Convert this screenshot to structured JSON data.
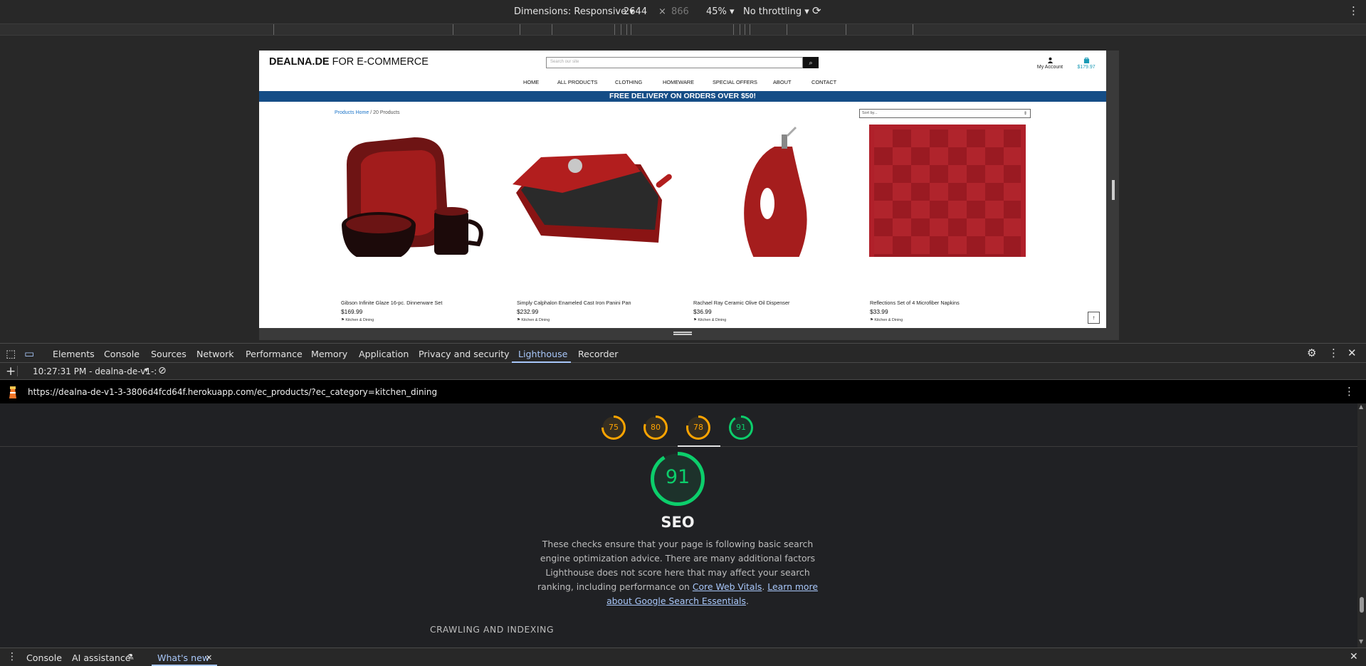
{
  "device_toolbar": {
    "dimensions_label": "Dimensions: Responsive",
    "width": "2644",
    "times": "×",
    "height": "866",
    "zoom": "45%",
    "throttling": "No throttling"
  },
  "site": {
    "logo_bold": "DEALNA.DE",
    "logo_rest": " FOR E-COMMERCE",
    "search_placeholder": "Search our site",
    "account_label": "My Account",
    "cart_total": "$179.97",
    "nav": [
      "HOME",
      "ALL PRODUCTS",
      "CLOTHING",
      "HOMEWARE",
      "SPECIAL OFFERS",
      "ABOUT",
      "CONTACT"
    ],
    "banner": "FREE DELIVERY ON ORDERS OVER $50!",
    "breadcrumb_link": "Products Home",
    "breadcrumb_count": " / 20 Products",
    "sort_label": "Sort by...",
    "products": [
      {
        "name": "Gibson Infinite Glaze 16-pc. Dinnerware Set",
        "price": "$169.99",
        "category": "Kitchen & Dining"
      },
      {
        "name": "Simply Calphalon Enameled Cast Iron Panini Pan",
        "price": "$232.99",
        "category": "Kitchen & Dining"
      },
      {
        "name": "Rachael Ray Ceramic Olive Oil Dispenser",
        "price": "$36.99",
        "category": "Kitchen & Dining"
      },
      {
        "name": "Reflections Set of 4 Microfiber Napkins",
        "price": "$33.99",
        "category": "Kitchen & Dining"
      }
    ]
  },
  "devtools": {
    "tabs": [
      "Elements",
      "Console",
      "Sources",
      "Network",
      "Performance",
      "Memory",
      "Application",
      "Privacy and security",
      "Lighthouse",
      "Recorder"
    ],
    "active_tab": "Lighthouse",
    "report_time": "10:27:31 PM - dealna-de-v1-:",
    "url": "https://dealna-de-v1-3-3806d4fcd64f.herokuapp.com/ec_products/?ec_category=kitchen_dining",
    "scores": [
      {
        "value": 75,
        "color": "#ffa400"
      },
      {
        "value": 80,
        "color": "#ffa400"
      },
      {
        "value": 78,
        "color": "#ffa400"
      },
      {
        "value": 91,
        "color": "#0cce6b"
      }
    ],
    "seo": {
      "score": 91,
      "title": "SEO",
      "desc_1": "These checks ensure that your page is following basic search engine optimization advice. There are many additional factors Lighthouse does not score here that may affect your search ranking, including performance on ",
      "link_1": "Core Web Vitals",
      "sep": ". ",
      "link_2": "Learn more about Google Search Essentials",
      "end": "."
    },
    "section": "CRAWLING AND INDEXING",
    "drawer": [
      "Console",
      "AI assistance",
      "What's new"
    ]
  }
}
